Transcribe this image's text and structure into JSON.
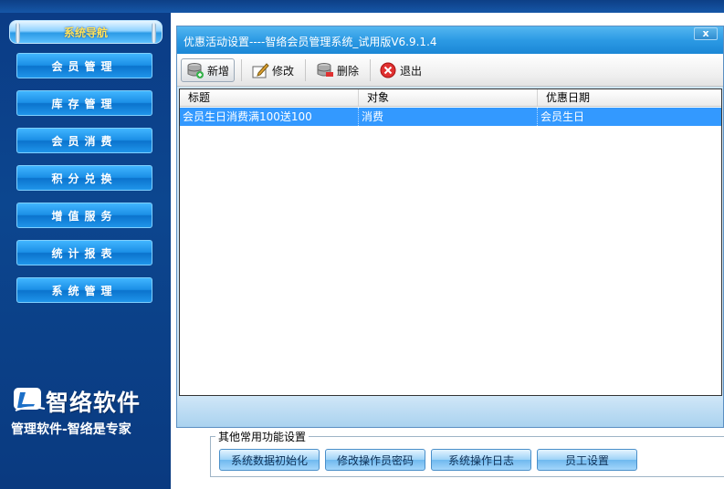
{
  "sidebar": {
    "header": "系统导航",
    "items": [
      {
        "label": "会员管理"
      },
      {
        "label": "库存管理"
      },
      {
        "label": "会员消费"
      },
      {
        "label": "积分兑换"
      },
      {
        "label": "增值服务"
      },
      {
        "label": "统计报表"
      },
      {
        "label": "系统管理"
      }
    ],
    "logo": {
      "name": "智络软件",
      "slogan": "管理软件-智络是专家"
    }
  },
  "dialog": {
    "title": "优惠活动设置----智络会员管理系统_试用版V6.9.1.4",
    "close_label": "x",
    "toolbar": {
      "add": "新增",
      "edit": "修改",
      "delete": "删除",
      "exit": "退出"
    },
    "grid": {
      "columns": [
        "标题",
        "对象",
        "优惠日期"
      ],
      "rows": [
        [
          "会员生日消费满100送100",
          "消费",
          "会员生日"
        ]
      ]
    }
  },
  "other_functions": {
    "title": "其他常用功能设置",
    "buttons": [
      {
        "label": "系统数据初始化"
      },
      {
        "label": "修改操作员密码"
      },
      {
        "label": "系统操作日志"
      },
      {
        "label": "员工设置"
      }
    ]
  },
  "colors": {
    "sidebar_bg": "#0b3c86",
    "selected_row": "#3399ff",
    "titlebar": "#2c9ae4"
  }
}
